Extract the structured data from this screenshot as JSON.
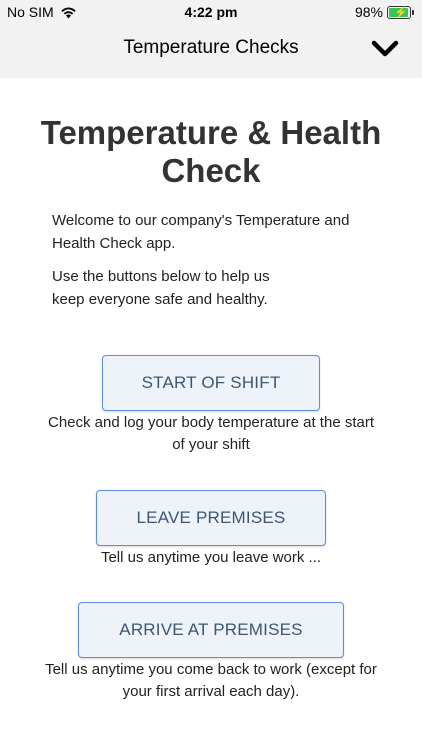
{
  "status_bar": {
    "carrier": "No SIM",
    "time": "4:22 pm",
    "battery": "98%",
    "battery_color": "#34c759"
  },
  "navbar": {
    "title": "Temperature Checks",
    "chevron_icon": "chevron-down-icon"
  },
  "content": {
    "title": "Temperature & Health Check",
    "intro_1": "Welcome to our company's Temperature and Health Check app.",
    "intro_2": "Use the buttons below to help us keep everyone safe and healthy."
  },
  "actions": [
    {
      "label": "START OF SHIFT",
      "description": "Check and log your body temperature at the start of your shift"
    },
    {
      "label": "LEAVE PREMISES",
      "description": "Tell us anytime you leave work ..."
    },
    {
      "label": "ARRIVE AT PREMISES",
      "description": "Tell us anytime you come back to work (except for your first arrival each day)."
    }
  ],
  "colors": {
    "button_border": "#5b8ed6",
    "button_bg": "#eef3fa",
    "button_text": "#3e5670"
  }
}
